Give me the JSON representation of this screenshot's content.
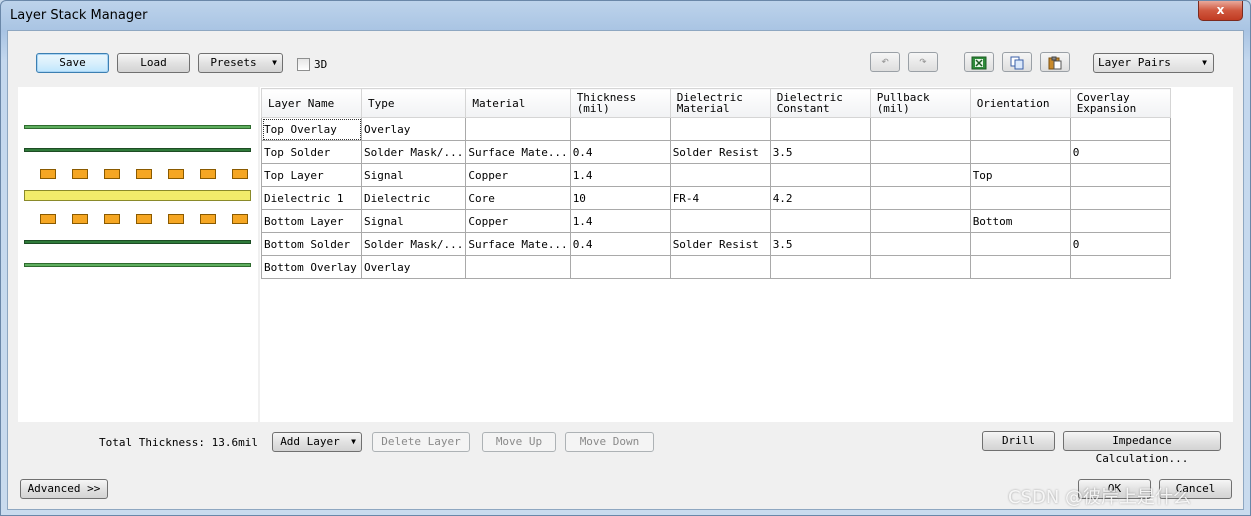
{
  "window": {
    "title": "Layer Stack Manager",
    "close": "x"
  },
  "toolbar": {
    "save": "Save",
    "load": "Load",
    "presets": "Presets",
    "three_d": "3D",
    "layer_pairs": "Layer Pairs"
  },
  "table": {
    "headers": [
      "Layer Name",
      "Type",
      "Material",
      "Thickness (mil)",
      "Dielectric Material",
      "Dielectric Constant",
      "Pullback (mil)",
      "Orientation",
      "Coverlay Expansion"
    ],
    "rows": [
      [
        "Top Overlay",
        "Overlay",
        "",
        "",
        "",
        "",
        "",
        "",
        ""
      ],
      [
        "Top Solder",
        "Solder Mask/...",
        "Surface Mate...",
        "0.4",
        "Solder Resist",
        "3.5",
        "",
        "",
        "0"
      ],
      [
        "Top Layer",
        "Signal",
        "Copper",
        "1.4",
        "",
        "",
        "",
        "Top",
        ""
      ],
      [
        "Dielectric 1",
        "Dielectric",
        "Core",
        "10",
        "FR-4",
        "4.2",
        "",
        "",
        ""
      ],
      [
        "Bottom Layer",
        "Signal",
        "Copper",
        "1.4",
        "",
        "",
        "",
        "Bottom",
        ""
      ],
      [
        "Bottom Solder",
        "Solder Mask/...",
        "Surface Mate...",
        "0.4",
        "Solder Resist",
        "3.5",
        "",
        "",
        "0"
      ],
      [
        "Bottom Overlay",
        "Overlay",
        "",
        "",
        "",
        "",
        "",
        "",
        ""
      ]
    ]
  },
  "stack_preview": {
    "colors": {
      "overlay": "#5fae5f",
      "solder": "#2f7a3a",
      "copper": "#f5a623",
      "dielectric": "#f2ec6a"
    }
  },
  "footer": {
    "total_thickness": "Total Thickness: 13.6mil",
    "add_layer": "Add Layer",
    "delete_layer": "Delete Layer",
    "move_up": "Move Up",
    "move_down": "Move Down",
    "drill": "Drill",
    "impedance": "Impedance Calculation...",
    "advanced": "Advanced >>",
    "ok": "OK",
    "cancel": "Cancel"
  },
  "watermark": "CSDN @彼岸上是什么"
}
